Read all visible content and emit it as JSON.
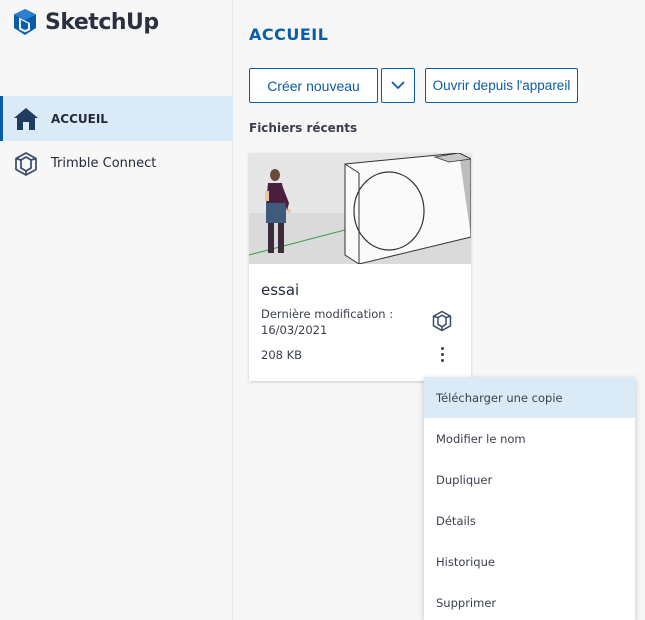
{
  "app": {
    "brand": "SketchUp"
  },
  "sidebar": {
    "items": [
      {
        "label": "ACCUEIL",
        "icon": "home-icon",
        "active": true
      },
      {
        "label": "Trimble Connect",
        "icon": "trimble-connect-icon",
        "active": false
      }
    ]
  },
  "main": {
    "title": "ACCUEIL",
    "create_label": "Créer nouveau",
    "dropdown_icon": "chevron-down-icon",
    "open_label": "Ouvrir depuis l'appareil",
    "recent_title": "Fichiers récents"
  },
  "files": [
    {
      "name": "essai",
      "modified_label": "Dernière modification :",
      "modified_date": "16/03/2021",
      "size": "208 KB",
      "cloud_icon": "trimble-connect-icon",
      "more_icon": "more-vertical-icon"
    }
  ],
  "context_menu": {
    "items": [
      {
        "label": "Télécharger une copie",
        "highlighted": true
      },
      {
        "label": "Modifier le nom"
      },
      {
        "label": "Dupliquer"
      },
      {
        "label": "Détails"
      },
      {
        "label": "Historique"
      },
      {
        "label": "Supprimer"
      }
    ]
  },
  "colors": {
    "accent": "#0b5ca6",
    "active_bg": "#daeaf7",
    "sidebar_bg": "#f7f7f8",
    "text": "#252a3a"
  }
}
